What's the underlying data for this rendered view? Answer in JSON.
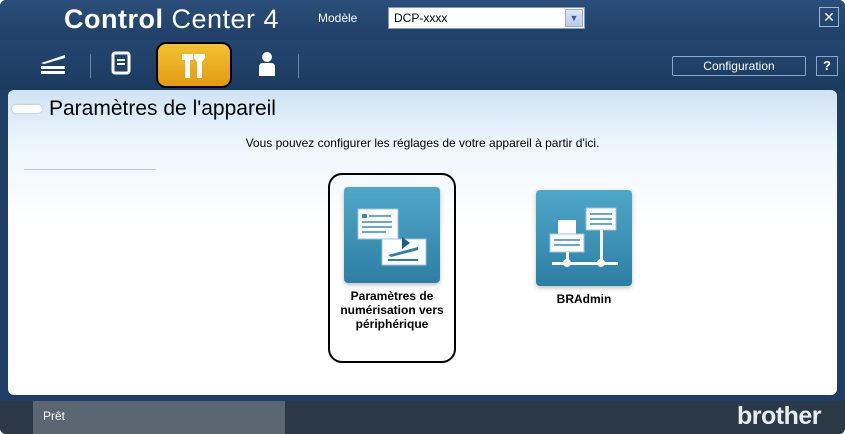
{
  "window": {
    "title_bold": "Control",
    "title_rest": " Center 4",
    "model_label": "Modèle",
    "model_value": "DCP-xxxx",
    "close_glyph": "✕"
  },
  "toolbar": {
    "tools": [
      {
        "name": "scan",
        "icon": "scanner-icon"
      },
      {
        "name": "basic",
        "icon": "document-icon"
      },
      {
        "name": "device-settings",
        "icon": "tools-icon",
        "active": true
      },
      {
        "name": "support",
        "icon": "person-icon"
      }
    ],
    "configuration_label": "Configuration",
    "help_label": "?"
  },
  "main": {
    "section_title": "Paramètres de l'appareil",
    "description": "Vous pouvez configurer les réglages de votre appareil à partir d'ici.",
    "apps": [
      {
        "label": "Paramètres de\nnumérisation vers\npériphérique",
        "icon": "scan-to-device-settings-icon"
      },
      {
        "label": "BRAdmin",
        "icon": "bradmin-network-icon"
      }
    ]
  },
  "status": {
    "text": "Prêt",
    "brand": "brother"
  },
  "colors": {
    "window_bg": "#1e3e63",
    "active_tab": "#f1c232",
    "icon_bg": "#2d7ea4"
  }
}
